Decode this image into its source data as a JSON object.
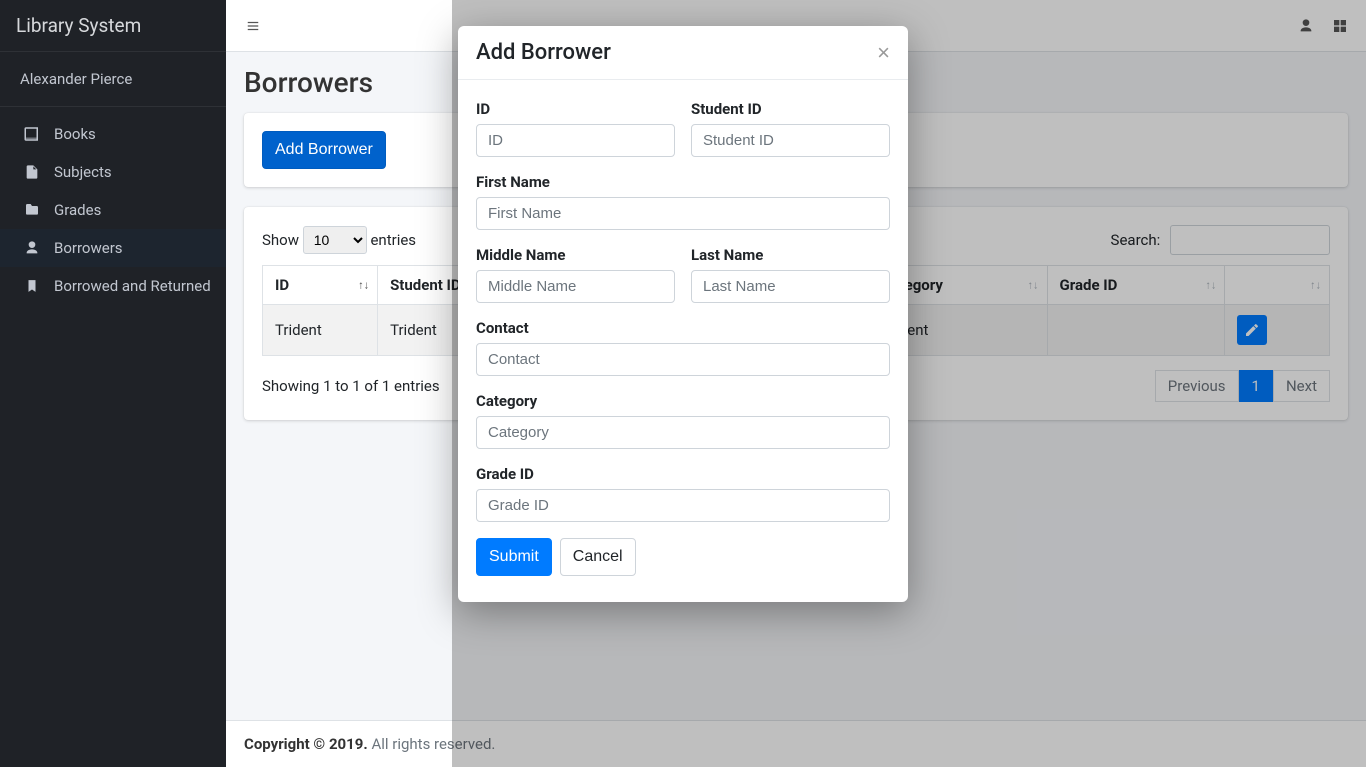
{
  "brand": "Library System",
  "user_name": "Alexander Pierce",
  "sidebar": {
    "items": [
      {
        "label": "Books",
        "icon": "book-icon"
      },
      {
        "label": "Subjects",
        "icon": "file-icon"
      },
      {
        "label": "Grades",
        "icon": "folder-icon"
      },
      {
        "label": "Borrowers",
        "icon": "user-icon"
      },
      {
        "label": "Borrowed and Returned",
        "icon": "bookmark-icon"
      }
    ]
  },
  "page": {
    "title": "Borrowers",
    "add_button": "Add Borrower"
  },
  "datatable": {
    "length_prefix": "Show",
    "length_value": "10",
    "length_suffix": "entries",
    "search_label": "Search:",
    "columns": [
      "ID",
      "Student ID",
      "",
      "",
      "Category",
      "Grade ID",
      ""
    ],
    "row": [
      "Trident",
      "Trident",
      "",
      "ident",
      "Trident",
      ""
    ],
    "info": "Showing 1 to 1 of 1 entries",
    "prev": "Previous",
    "page": "1",
    "next": "Next"
  },
  "footer": {
    "copyright_strong": "Copyright © 2019.",
    "copyright_rest": " All rights reserved."
  },
  "modal": {
    "title": "Add Borrower",
    "fields": {
      "id": {
        "label": "ID",
        "placeholder": "ID"
      },
      "student_id": {
        "label": "Student ID",
        "placeholder": "Student ID"
      },
      "first_name": {
        "label": "First Name",
        "placeholder": "First Name"
      },
      "middle_name": {
        "label": "Middle Name",
        "placeholder": "Middle Name"
      },
      "last_name": {
        "label": "Last Name",
        "placeholder": "Last Name"
      },
      "contact": {
        "label": "Contact",
        "placeholder": "Contact"
      },
      "category": {
        "label": "Category",
        "placeholder": "Category"
      },
      "grade_id": {
        "label": "Grade ID",
        "placeholder": "Grade ID"
      }
    },
    "submit": "Submit",
    "cancel": "Cancel"
  }
}
